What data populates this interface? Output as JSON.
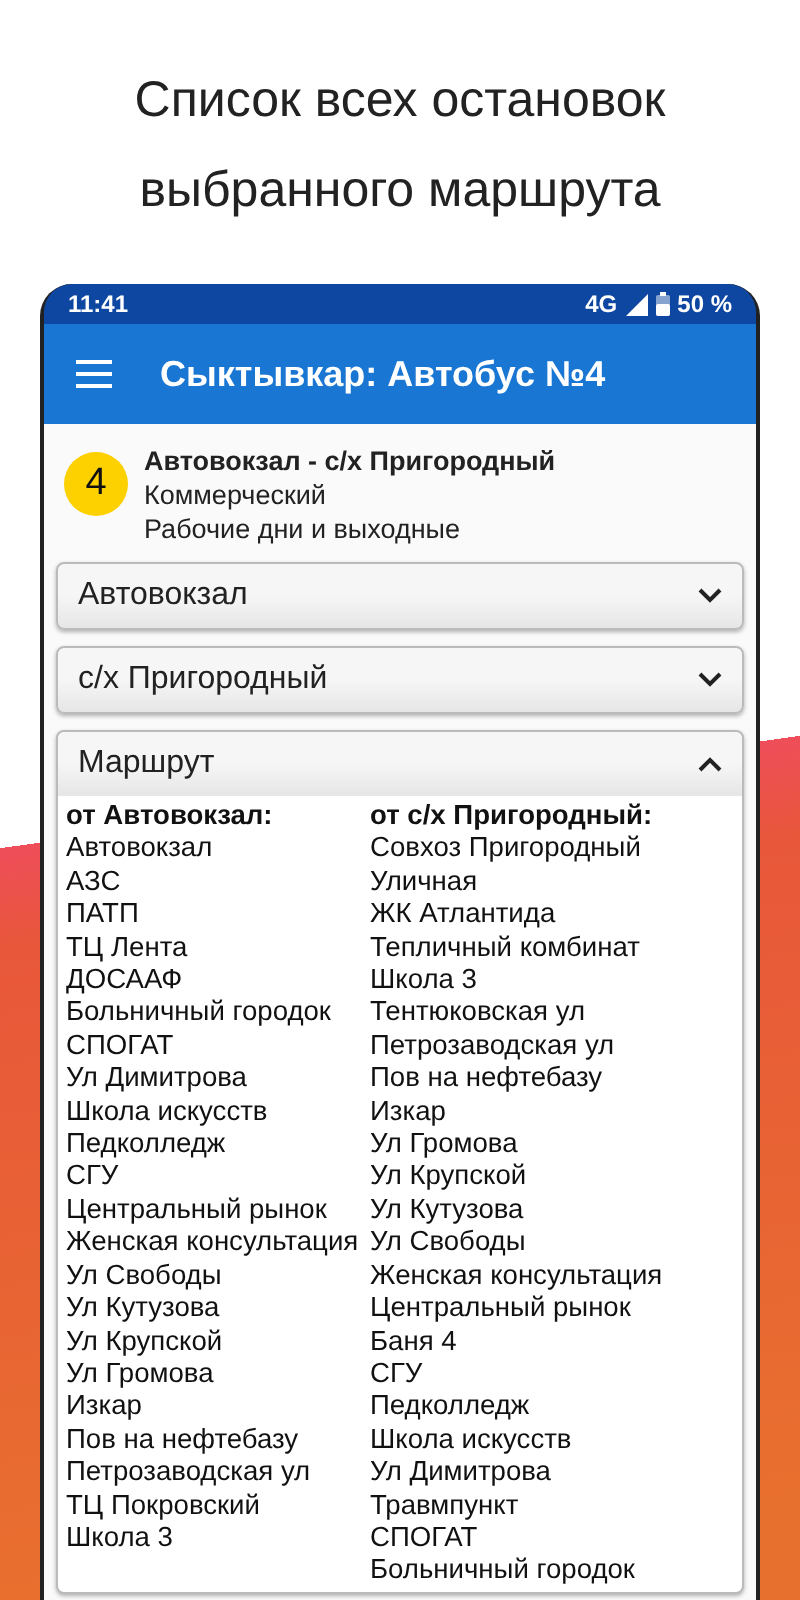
{
  "headline": [
    "Список всех остановок",
    "выбранного маршрута"
  ],
  "status_bar": {
    "time": "11:41",
    "network": "4G",
    "battery": "50 %"
  },
  "app_bar": {
    "title": "Сыктывкар: Автобус №4"
  },
  "route": {
    "number": "4",
    "name": "Автовокзал - с/х Пригородный",
    "type": "Коммерческий",
    "days": "Рабочие дни и выходные"
  },
  "selects": [
    {
      "value": "Автовокзал",
      "expanded": false
    },
    {
      "value": "с/х Пригородный",
      "expanded": false
    }
  ],
  "accordion": {
    "title": "Маршрут",
    "expanded": true,
    "columns": [
      {
        "heading": "от Автовокзал:",
        "stops": [
          "Автовокзал",
          "АЗС",
          "ПАТП",
          "ТЦ Лента",
          "ДОСААФ",
          "Больничный городок",
          "СПОГАТ",
          "Ул Димитрова",
          "Школа искусств",
          "Педколледж",
          "СГУ",
          "Центральный рынок",
          "Женская консультация",
          "Ул Свободы",
          "Ул Кутузова",
          "Ул Крупской",
          "Ул Громова",
          "Изкар",
          "Пов на нефтебазу",
          "Петрозаводская ул",
          "ТЦ Покровский",
          "Школа 3"
        ]
      },
      {
        "heading": "от с/х Пригородный:",
        "stops": [
          "Совхоз Пригородный",
          "Уличная",
          "ЖК Атлантида",
          "Тепличный комбинат",
          "Школа 3",
          "Тентюковская ул",
          "Петрозаводская ул",
          "Пов на нефтебазу",
          "Изкар",
          "Ул Громова",
          "Ул Крупской",
          "Ул Кутузова",
          "Ул Свободы",
          "Женская консультация",
          "Центральный рынок",
          "Баня 4",
          "СГУ",
          "Педколледж",
          "Школа искусств",
          "Ул Димитрова",
          "Травмпункт",
          "СПОГАТ",
          "Больничный городок"
        ]
      }
    ]
  }
}
